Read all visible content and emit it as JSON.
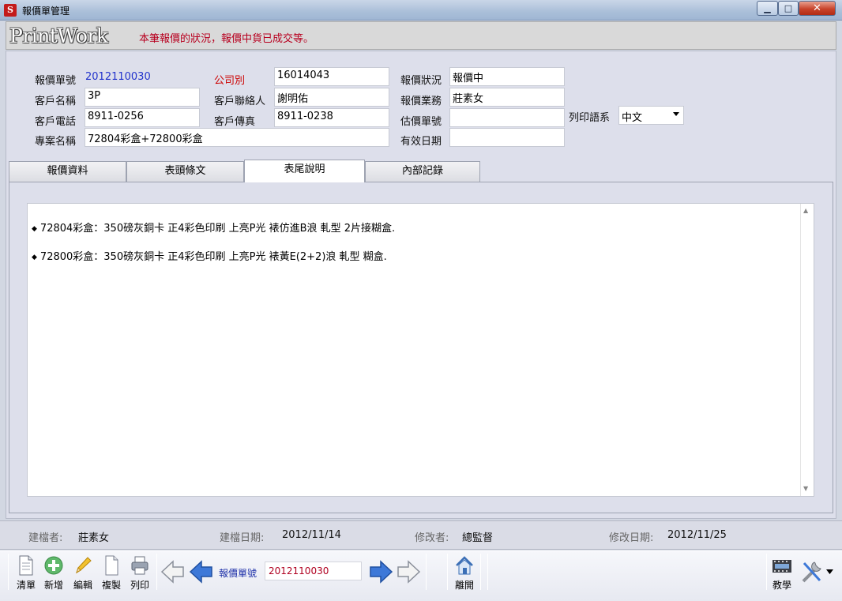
{
  "window": {
    "title": "報價單管理",
    "icon_text": "S",
    "min_glyph": "▁",
    "max_glyph": "□",
    "close_glyph": "✕"
  },
  "banner": {
    "logo": "PrintWork",
    "status_message": "本筆報價的狀況，報價中貨已成交等。"
  },
  "form": {
    "quote_no_label": "報價單號",
    "quote_no_value": "2012110030",
    "company_label": "公司別",
    "company_value": "16014043",
    "quote_status_label": "報價狀況",
    "quote_status_value": "報價中",
    "customer_name_label": "客戶名稱",
    "customer_name_value": "3P",
    "contact_label": "客戶聯絡人",
    "contact_value": "謝明佑",
    "sales_label": "報價業務",
    "sales_value": "莊素女",
    "phone_label": "客戶電話",
    "phone_value": "8911-0256",
    "fax_label": "客戶傳真",
    "fax_value": "8911-0238",
    "estimate_no_label": "估價單號",
    "estimate_no_value": "",
    "print_lang_label": "列印語系",
    "print_lang_value": "中文",
    "project_label": "專案名稱",
    "project_value": "72804彩盒+72800彩盒",
    "valid_date_label": "有效日期",
    "valid_date_value": ""
  },
  "tabs": [
    {
      "label": "報價資料",
      "active": false
    },
    {
      "label": "表頭條文",
      "active": false
    },
    {
      "label": "表尾說明",
      "active": true
    },
    {
      "label": "內部記錄",
      "active": false
    }
  ],
  "memo": {
    "bullet": "◆",
    "lines": [
      "72804彩盒：350磅灰銅卡 正4彩色印刷 上亮P光 裱仿進B浪 軋型 2片接糊盒.",
      "72800彩盒：350磅灰銅卡 正4彩色印刷 上亮P光 裱黃E(2+2)浪 軋型 糊盒."
    ],
    "scroll_up": "▲",
    "scroll_down": "▼"
  },
  "audit": {
    "creator_label": "建檔者:",
    "creator_value": "莊素女",
    "created_date_label": "建檔日期:",
    "created_date_value": "2012/11/14",
    "modifier_label": "修改者:",
    "modifier_value": "總監督",
    "modified_date_label": "修改日期:",
    "modified_date_value": "2012/11/25"
  },
  "toolbar": {
    "list": "清單",
    "add": "新增",
    "edit": "編輯",
    "copy": "複製",
    "print": "列印",
    "nav_label": "報價單號",
    "nav_value": "2012110030",
    "exit": "離開",
    "tutorial": "教學"
  },
  "colors": {
    "accent_red": "#b8001f",
    "link_blue": "#2233cc",
    "nav_arrow_blue": "#3d78d8"
  }
}
